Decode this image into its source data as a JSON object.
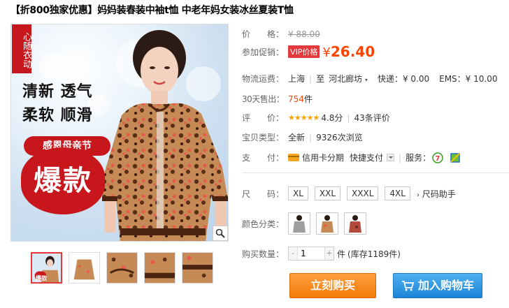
{
  "title": {
    "promo": "【折800独家优惠】",
    "text": "妈妈装春装中袖t恤 中老年妈女装冰丝夏装T恤"
  },
  "image": {
    "tag": "心随衣动",
    "slogan1": "清新 透气",
    "slogan2": "柔软 顺滑",
    "festival": "感恩母亲节",
    "hot": "爆款"
  },
  "thumb_hot": "爆款",
  "price": {
    "label": "价　　格：",
    "value": "¥ 88.00"
  },
  "promo": {
    "label": "参加促销：",
    "badge": "VIP价格",
    "symbol": "¥",
    "value": "26.40"
  },
  "shipping": {
    "label": "物流运费：",
    "from": "上海",
    "sep": "至",
    "to": "河北廊坊",
    "express": "快递：¥ 0.00",
    "ems": "EMS：¥ 10.00"
  },
  "sold": {
    "label": "30天售出：",
    "count": "754",
    "unit": "件"
  },
  "rating": {
    "label": "评　　价：",
    "stars": "★★★★★",
    "score": "4.8分",
    "reviews": "43条评价"
  },
  "type": {
    "label": "宝贝类型：",
    "condition": "全新",
    "views": "9326次浏览"
  },
  "payment": {
    "label": "支　　付：",
    "credit": "信用卡分期",
    "quick": "快捷支付",
    "service": "服务："
  },
  "size": {
    "label": "尺　　码：",
    "options": [
      "XL",
      "XXL",
      "XXXL",
      "4XL"
    ],
    "helper": "尺码助手"
  },
  "colors": {
    "label": "颜色分类："
  },
  "quantity": {
    "label": "购买数量：",
    "minus": "-",
    "value": "1",
    "plus": "+",
    "unit": "件",
    "stock": "(库存1189件)"
  },
  "buttons": {
    "buy": "立刻购买",
    "cart": "加入购物车"
  },
  "colors_palette": {
    "accent": "#f40",
    "red": "#e4393c",
    "orange_btn": "#f27b06",
    "blue_btn": "#1d84d6"
  }
}
